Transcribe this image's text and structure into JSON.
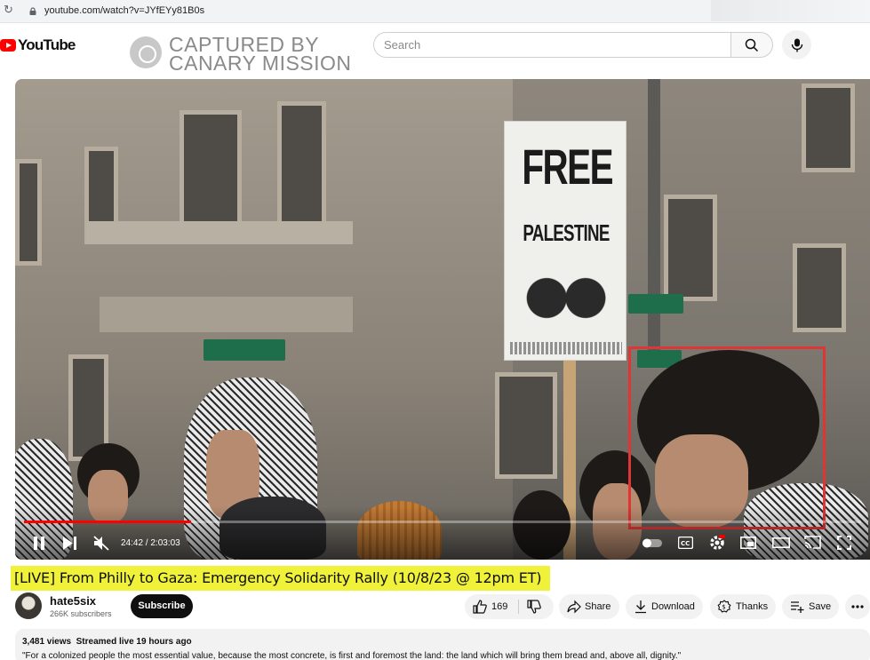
{
  "browser": {
    "url": "youtube.com/watch?v=JYfEYy81B0s"
  },
  "header": {
    "logo_text": "YouTube",
    "watermark_line1": "CAPTURED BY",
    "watermark_line2": "CANARY MISSION",
    "search_placeholder": "Search"
  },
  "video": {
    "sign_line1": "FREE",
    "sign_line2": "PALESTINE",
    "sign_footer": "PARTY FOR SOCIALISM AND LIBERATION @PSLPHILLY | PHILLY@PSLWEB.ORG",
    "time_display": "24:42 / 2:03:03",
    "progress_fraction": 0.2
  },
  "title": "[LIVE] From Philly to Gaza: Emergency Solidarity Rally (10/8/23 @ 12pm ET)",
  "channel": {
    "name": "hate5six",
    "subscribers": "266K subscribers",
    "subscribe_label": "Subscribe"
  },
  "actions": {
    "likes": "169",
    "share": "Share",
    "download": "Download",
    "thanks": "Thanks",
    "save": "Save"
  },
  "description": {
    "views": "3,481 views",
    "streamed": "Streamed live 19 hours ago",
    "quote": "\"For a colonized people the most essential value, because the most concrete, is first and foremost the land: the land which will bring them bread and, above all, dignity.\""
  },
  "colors": {
    "brand_red": "#ff0000",
    "highlight_yellow": "#f0f23a",
    "annotation_red": "#e03535"
  }
}
